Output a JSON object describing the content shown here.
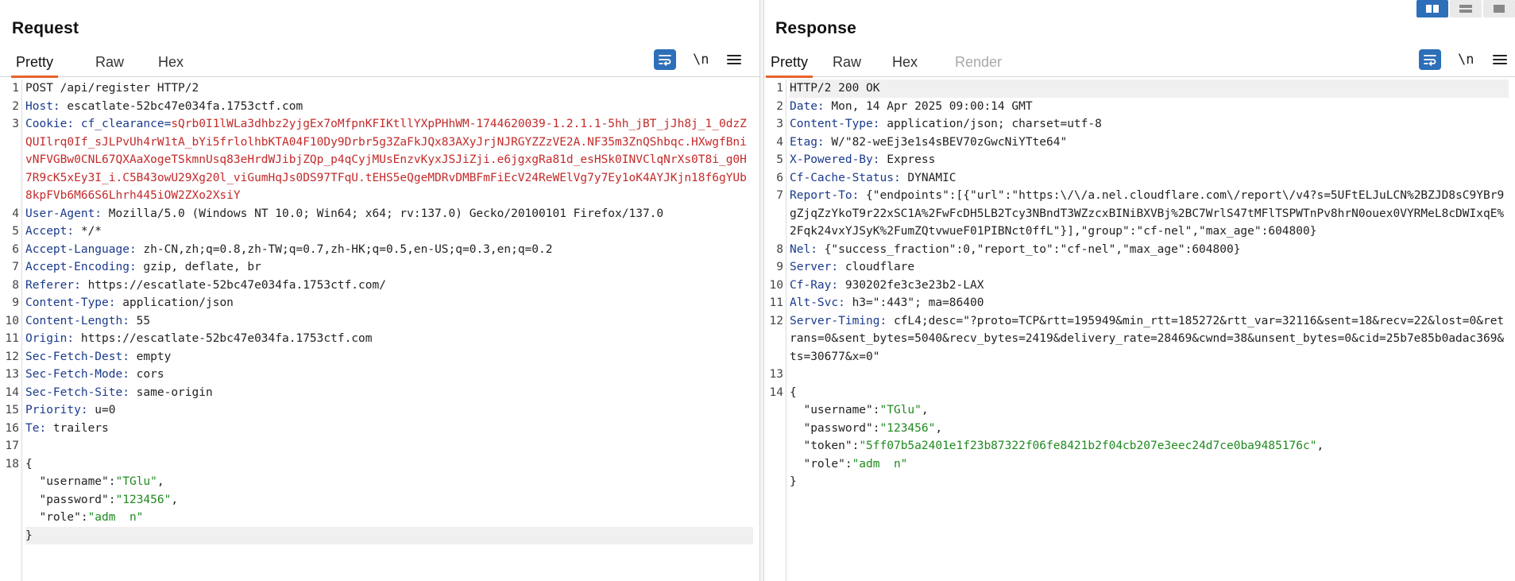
{
  "request": {
    "title": "Request",
    "tabs": [
      "Pretty",
      "Raw",
      "Hex"
    ],
    "newline_label": "\\n",
    "lines": [
      {
        "n": "1",
        "segs": [
          {
            "t": "POST /api/register HTTP/2",
            "c": "hv"
          }
        ]
      },
      {
        "n": "2",
        "segs": [
          {
            "t": "Host:",
            "c": "hk"
          },
          {
            "t": " escatlate-52bc47e034fa.1753ctf.com",
            "c": "hv"
          }
        ]
      },
      {
        "n": "3",
        "segs": [
          {
            "t": "Cookie:",
            "c": "hk"
          },
          {
            "t": " cf_clearance=",
            "c": "hk"
          },
          {
            "t": "sQrb0I1lWLa3dhbz2yjgEx7oMfpnKFIKtllYXpPHhWM-1744620039-1.2.1.1-5hh_jBT_jJh8j_1_0dzZQUIlrq0If_sJLPvUh4rW1tA_bYi5frlolhbKTA04F10Dy9Drbr5g3ZaFkJQx83AXyJrjNJRGYZZzVE2A.NF35m3ZnQShbqc.HXwgfBnivNFVGBw0CNL67QXAaXogeTSkmnUsq83eHrdWJibjZQp_p4qCyjMUsEnzvKyxJSJiZji.e6jgxgRa81d_esHSk0INVClqNrXs0T8i_g0H7R9cK5xEy3I_i.C5B43owU29Xg20l_viGumHqJs0DS97TFqU.tEHS5eQgeMDRvDMBFmFiEcV24ReWElVg7y7Ey1oK4AYJKjn18f6gYUb8kpFVb6M66S6Lhrh445iOW2ZXo2XsiY",
            "c": "ck"
          }
        ]
      },
      {
        "n": "4",
        "segs": [
          {
            "t": "User-Agent:",
            "c": "hk"
          },
          {
            "t": " Mozilla/5.0 (Windows NT 10.0; Win64; x64; rv:137.0) Gecko/20100101 Firefox/137.0",
            "c": "hv"
          }
        ]
      },
      {
        "n": "5",
        "segs": [
          {
            "t": "Accept:",
            "c": "hk"
          },
          {
            "t": " */*",
            "c": "hv"
          }
        ]
      },
      {
        "n": "6",
        "segs": [
          {
            "t": "Accept-Language:",
            "c": "hk"
          },
          {
            "t": " zh-CN,zh;q=0.8,zh-TW;q=0.7,zh-HK;q=0.5,en-US;q=0.3,en;q=0.2",
            "c": "hv"
          }
        ]
      },
      {
        "n": "7",
        "segs": [
          {
            "t": "Accept-Encoding:",
            "c": "hk"
          },
          {
            "t": " gzip, deflate, br",
            "c": "hv"
          }
        ]
      },
      {
        "n": "8",
        "segs": [
          {
            "t": "Referer:",
            "c": "hk"
          },
          {
            "t": " https://escatlate-52bc47e034fa.1753ctf.com/",
            "c": "hv"
          }
        ]
      },
      {
        "n": "9",
        "segs": [
          {
            "t": "Content-Type:",
            "c": "hk"
          },
          {
            "t": " application/json",
            "c": "hv"
          }
        ]
      },
      {
        "n": "10",
        "segs": [
          {
            "t": "Content-Length:",
            "c": "hk"
          },
          {
            "t": " 55",
            "c": "hv"
          }
        ]
      },
      {
        "n": "11",
        "segs": [
          {
            "t": "Origin:",
            "c": "hk"
          },
          {
            "t": " https://escatlate-52bc47e034fa.1753ctf.com",
            "c": "hv"
          }
        ]
      },
      {
        "n": "12",
        "segs": [
          {
            "t": "Sec-Fetch-Dest:",
            "c": "hk"
          },
          {
            "t": " empty",
            "c": "hv"
          }
        ]
      },
      {
        "n": "13",
        "segs": [
          {
            "t": "Sec-Fetch-Mode:",
            "c": "hk"
          },
          {
            "t": " cors",
            "c": "hv"
          }
        ]
      },
      {
        "n": "14",
        "segs": [
          {
            "t": "Sec-Fetch-Site:",
            "c": "hk"
          },
          {
            "t": " same-origin",
            "c": "hv"
          }
        ]
      },
      {
        "n": "15",
        "segs": [
          {
            "t": "Priority:",
            "c": "hk"
          },
          {
            "t": " u=0",
            "c": "hv"
          }
        ]
      },
      {
        "n": "16",
        "segs": [
          {
            "t": "Te:",
            "c": "hk"
          },
          {
            "t": " trailers",
            "c": "hv"
          }
        ]
      },
      {
        "n": "17",
        "segs": [
          {
            "t": " ",
            "c": "hv"
          }
        ]
      },
      {
        "n": "18",
        "segs": [
          {
            "t": "{",
            "c": "hv"
          }
        ]
      },
      {
        "n": "",
        "segs": [
          {
            "t": "  \"username\":",
            "c": "jk"
          },
          {
            "t": "\"TGlu\"",
            "c": "js"
          },
          {
            "t": ",",
            "c": "jk"
          }
        ]
      },
      {
        "n": "",
        "segs": [
          {
            "t": "  \"password\":",
            "c": "jk"
          },
          {
            "t": "\"123456\"",
            "c": "js"
          },
          {
            "t": ",",
            "c": "jk"
          }
        ]
      },
      {
        "n": "",
        "segs": [
          {
            "t": "  \"role\":",
            "c": "jk"
          },
          {
            "t": "\"adm  n\"",
            "c": "js"
          }
        ]
      },
      {
        "n": "",
        "hl": true,
        "segs": [
          {
            "t": "}",
            "c": "jk"
          }
        ]
      }
    ]
  },
  "response": {
    "title": "Response",
    "tabs": [
      "Pretty",
      "Raw",
      "Hex",
      "Render"
    ],
    "newline_label": "\\n",
    "lines": [
      {
        "n": "1",
        "hl": true,
        "segs": [
          {
            "t": "HTTP/2 200 OK",
            "c": "hv"
          }
        ]
      },
      {
        "n": "2",
        "segs": [
          {
            "t": "Date:",
            "c": "hk"
          },
          {
            "t": " Mon, 14 Apr 2025 09:00:14 GMT",
            "c": "hv"
          }
        ]
      },
      {
        "n": "3",
        "segs": [
          {
            "t": "Content-Type:",
            "c": "hk"
          },
          {
            "t": " application/json; charset=utf-8",
            "c": "hv"
          }
        ]
      },
      {
        "n": "4",
        "segs": [
          {
            "t": "Etag:",
            "c": "hk"
          },
          {
            "t": " W/\"82-weEj3e1s4sBEV70zGwcNiYTte64\"",
            "c": "hv"
          }
        ]
      },
      {
        "n": "5",
        "segs": [
          {
            "t": "X-Powered-By:",
            "c": "hk"
          },
          {
            "t": " Express",
            "c": "hv"
          }
        ]
      },
      {
        "n": "6",
        "segs": [
          {
            "t": "Cf-Cache-Status:",
            "c": "hk"
          },
          {
            "t": " DYNAMIC",
            "c": "hv"
          }
        ]
      },
      {
        "n": "7",
        "segs": [
          {
            "t": "Report-To:",
            "c": "hk"
          },
          {
            "t": " {\"endpoints\":[{\"url\":\"https:\\/\\/a.nel.cloudflare.com\\/report\\/v4?s=5UFtELJuLCN%2BZJD8sC9YBr9gZjqZzYkoT9r22xSC1A%2FwFcDH5LB2Tcy3NBndT3WZzcxBINiBXVBj%2BC7WrlS47tMFlTSPWTnPv8hrN0ouex0VYRMeL8cDWIxqE%2Fqk24vxYJSyK%2FumZQtvwueF01PIBNct0ffL\"}],\"group\":\"cf-nel\",\"max_age\":604800}",
            "c": "hv"
          }
        ]
      },
      {
        "n": "8",
        "segs": [
          {
            "t": "Nel:",
            "c": "hk"
          },
          {
            "t": " {\"success_fraction\":0,\"report_to\":\"cf-nel\",\"max_age\":604800}",
            "c": "hv"
          }
        ]
      },
      {
        "n": "9",
        "segs": [
          {
            "t": "Server:",
            "c": "hk"
          },
          {
            "t": " cloudflare",
            "c": "hv"
          }
        ]
      },
      {
        "n": "10",
        "segs": [
          {
            "t": "Cf-Ray:",
            "c": "hk"
          },
          {
            "t": " 930202fe3c3e23b2-LAX",
            "c": "hv"
          }
        ]
      },
      {
        "n": "11",
        "segs": [
          {
            "t": "Alt-Svc:",
            "c": "hk"
          },
          {
            "t": " h3=\":443\"; ma=86400",
            "c": "hv"
          }
        ]
      },
      {
        "n": "12",
        "segs": [
          {
            "t": "Server-Timing:",
            "c": "hk"
          },
          {
            "t": " cfL4;desc=\"?proto=TCP&rtt=195949&min_rtt=185272&rtt_var=32116&sent=18&recv=22&lost=0&retrans=0&sent_bytes=5040&recv_bytes=2419&delivery_rate=28469&cwnd=38&unsent_bytes=0&cid=25b7e85b0adac369&ts=30677&x=0\"",
            "c": "hv"
          }
        ]
      },
      {
        "n": "13",
        "segs": [
          {
            "t": " ",
            "c": "hv"
          }
        ]
      },
      {
        "n": "14",
        "segs": [
          {
            "t": "{",
            "c": "jk"
          }
        ]
      },
      {
        "n": "",
        "segs": [
          {
            "t": "  \"username\":",
            "c": "jk"
          },
          {
            "t": "\"TGlu\"",
            "c": "js"
          },
          {
            "t": ",",
            "c": "jk"
          }
        ]
      },
      {
        "n": "",
        "segs": [
          {
            "t": "  \"password\":",
            "c": "jk"
          },
          {
            "t": "\"123456\"",
            "c": "js"
          },
          {
            "t": ",",
            "c": "jk"
          }
        ]
      },
      {
        "n": "",
        "segs": [
          {
            "t": "  \"token\":",
            "c": "jk"
          },
          {
            "t": "\"5ff07b5a2401e1f23b87322f06fe8421b2f04cb207e3eec24d7ce0ba9485176c\"",
            "c": "js"
          },
          {
            "t": ",",
            "c": "jk"
          }
        ]
      },
      {
        "n": "",
        "segs": [
          {
            "t": "  \"role\":",
            "c": "jk"
          },
          {
            "t": "\"adm  n\"",
            "c": "js"
          }
        ]
      },
      {
        "n": "",
        "segs": [
          {
            "t": "}",
            "c": "jk"
          }
        ]
      }
    ]
  },
  "icons": {
    "wrap": "text-wrap-icon",
    "menu": "hamburger-menu-icon",
    "layout": [
      "layout-side-by-side-icon",
      "layout-stacked-icon",
      "layout-single-icon"
    ]
  },
  "colors": {
    "accent": "#e8642b",
    "button_blue": "#2d6fb8",
    "header_key": "#1a3a8c",
    "cookie_value": "#c42a2a",
    "json_string": "#1f8a1f"
  }
}
